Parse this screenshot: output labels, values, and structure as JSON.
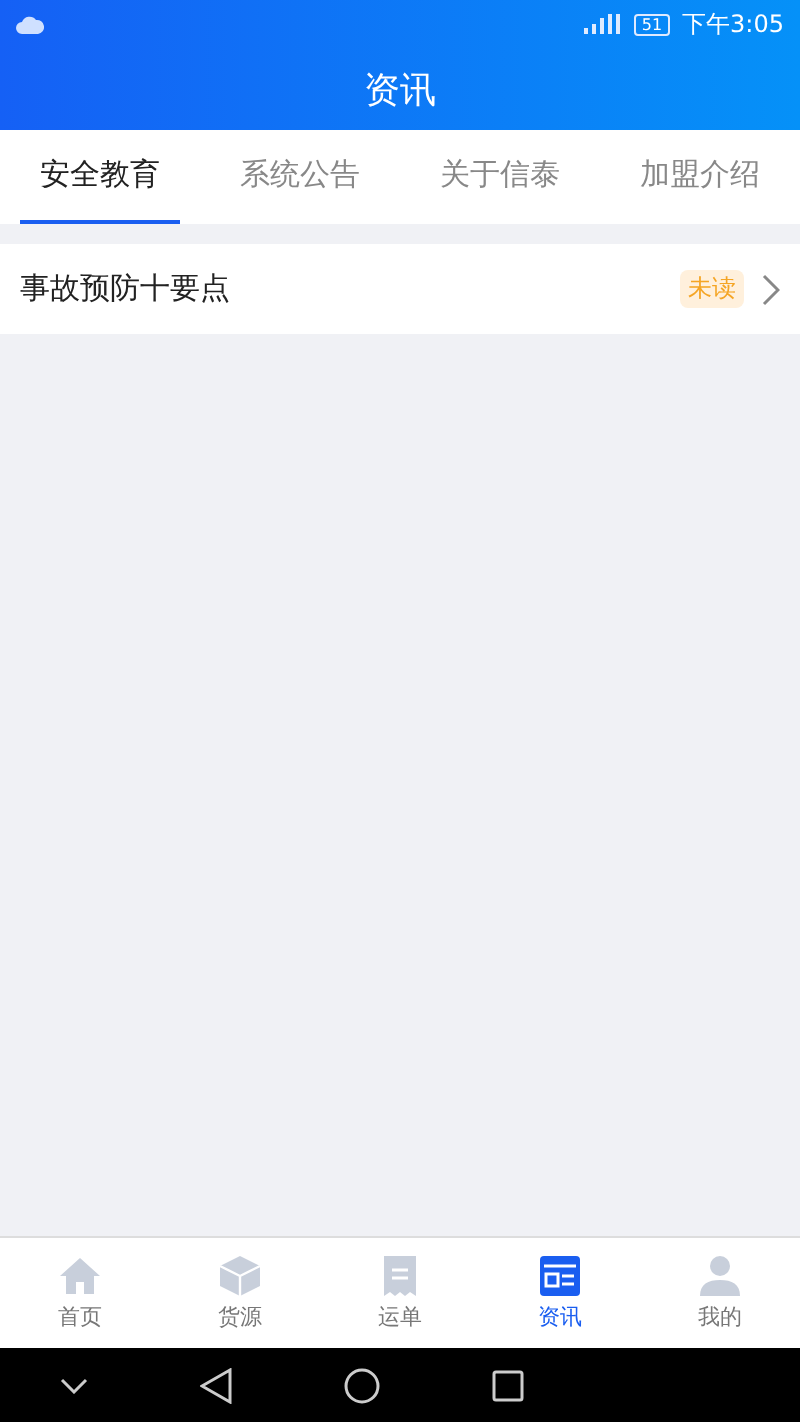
{
  "status_bar": {
    "battery": "51",
    "time": "下午3:05"
  },
  "header": {
    "title": "资讯"
  },
  "tabs": [
    {
      "label": "安全教育",
      "selected": true
    },
    {
      "label": "系统公告",
      "selected": false
    },
    {
      "label": "关于信泰",
      "selected": false
    },
    {
      "label": "加盟介绍",
      "selected": false
    }
  ],
  "articles": [
    {
      "title": "事故预防十要点",
      "badge": "未读"
    }
  ],
  "bottom_nav": [
    {
      "label": "首页",
      "kind": "home",
      "selected": false
    },
    {
      "label": "货源",
      "kind": "box",
      "selected": false
    },
    {
      "label": "运单",
      "kind": "receipt",
      "selected": false
    },
    {
      "label": "资讯",
      "kind": "news",
      "selected": true
    },
    {
      "label": "我的",
      "kind": "person",
      "selected": false
    }
  ]
}
